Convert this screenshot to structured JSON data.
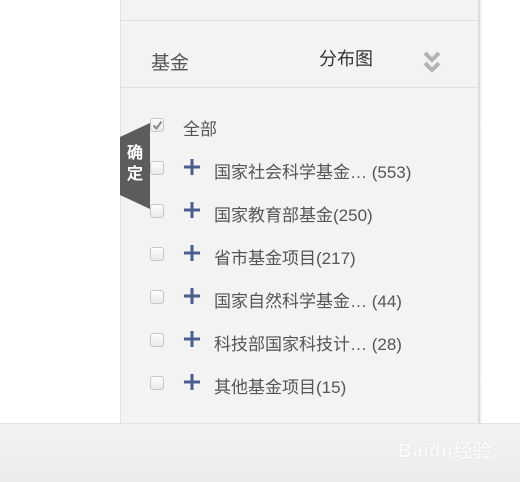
{
  "facet": {
    "title": "基金",
    "distribution_link": "分布图",
    "expand_icon": "double-chevron-down-icon"
  },
  "confirm_button": {
    "label": "确定"
  },
  "options": {
    "all_label": "全部",
    "all_checked": true,
    "items": [
      {
        "label": "国家社会科学基金… (553)"
      },
      {
        "label": "国家教育部基金(250)"
      },
      {
        "label": "省市基金项目(217)"
      },
      {
        "label": "国家自然科学基金… (44)"
      },
      {
        "label": "科技部国家科技计… (28)"
      },
      {
        "label": "其他基金项目(15)"
      }
    ]
  },
  "watermark": {
    "text": "Baidu经验"
  },
  "colors": {
    "plus": "#4b5e8f",
    "confirm_tab": "#5c5c5c"
  }
}
